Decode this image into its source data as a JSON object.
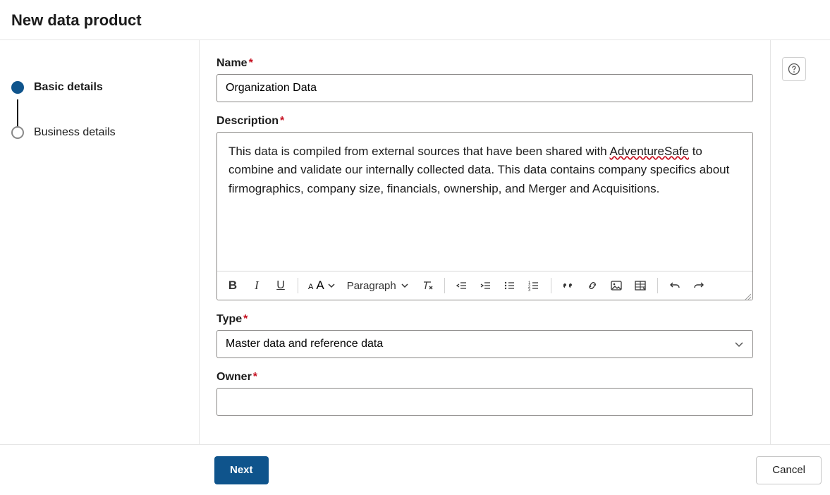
{
  "header": {
    "title": "New data product"
  },
  "stepper": {
    "steps": [
      {
        "label": "Basic details",
        "active": true
      },
      {
        "label": "Business details",
        "active": false
      }
    ]
  },
  "form": {
    "name_label": "Name",
    "name_value": "Organization Data",
    "description_label": "Description",
    "description_value_prefix": "This data is compiled from external sources that have been shared with ",
    "description_value_spell": "AdventureSafe",
    "description_value_suffix": " to combine and validate our internally collected data.  This data contains company specifics about firmographics, company size, financials, ownership, and Merger and Acquisitions.",
    "type_label": "Type",
    "type_value": "Master data and reference data",
    "owner_label": "Owner",
    "owner_value": ""
  },
  "toolbar": {
    "paragraph_label": "Paragraph"
  },
  "footer": {
    "next_label": "Next",
    "cancel_label": "Cancel"
  }
}
